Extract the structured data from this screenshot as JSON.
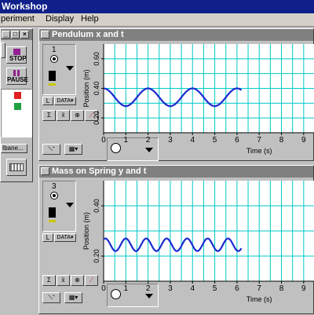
{
  "app": {
    "title": "Workshop"
  },
  "menu": [
    "periment",
    "Display",
    "Help"
  ],
  "controls": {
    "stop_label": "STOP",
    "pause_label": "PAUSE",
    "btn_label": "Ibane..."
  },
  "colors": {
    "graph_line": "#1a2bd0",
    "grid": "#00c8c8",
    "title_bg": "#808080",
    "app_title_bg": "#10208a",
    "flag_red": "#e02020",
    "flag_green": "#20a040"
  },
  "graphs": [
    {
      "title": "Pendulum x and t",
      "probe_number": "1",
      "y_axis_label": "Position (m)",
      "y_ticks": [
        "0.20",
        "0.40",
        "0.60"
      ],
      "x_axis_label": "Time (s)",
      "x_ticks": [
        "0",
        "1",
        "2",
        "3",
        "4",
        "5",
        "6",
        "7",
        "8",
        "9"
      ],
      "chart_data": {
        "type": "line",
        "xlabel": "Time (s)",
        "ylabel": "Position (m)",
        "xlim": [
          0,
          9.5
        ],
        "ylim": [
          0.1,
          0.7
        ],
        "grid": true,
        "series": [
          {
            "model": "sine",
            "x_start": 0,
            "x_end": 6.2,
            "center": 0.34,
            "amplitude": 0.06,
            "period": 2.0,
            "phase_deg": 90
          }
        ]
      }
    },
    {
      "title": "Mass on Spring y and t",
      "probe_number": "3",
      "y_axis_label": "Position (m)",
      "y_ticks": [
        "0.20",
        "0.40"
      ],
      "x_axis_label": "Time (s)",
      "x_ticks": [
        "0",
        "1",
        "2",
        "3",
        "4",
        "5",
        "6",
        "7",
        "8",
        "9"
      ],
      "chart_data": {
        "type": "line",
        "xlabel": "Time (s)",
        "ylabel": "Position (m)",
        "xlim": [
          0,
          9.5
        ],
        "ylim": [
          0.1,
          0.5
        ],
        "grid": true,
        "series": [
          {
            "model": "sine",
            "x_start": 0,
            "x_end": 6.2,
            "center": 0.245,
            "amplitude": 0.025,
            "period": 0.92,
            "phase_deg": 60
          }
        ]
      }
    }
  ]
}
